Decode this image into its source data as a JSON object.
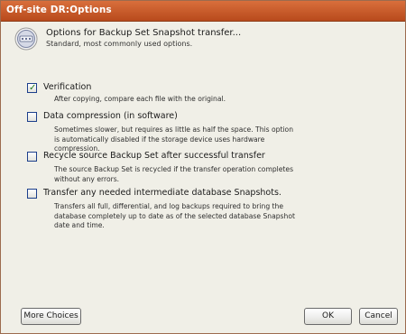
{
  "window": {
    "title": "Off-site DR:Options"
  },
  "header": {
    "title": "Options for Backup Set Snapshot transfer...",
    "subtitle": "Standard, most commonly used options."
  },
  "options": [
    {
      "label": "Verification",
      "checked": true,
      "description": "After copying, compare each file with the original."
    },
    {
      "label": "Data compression (in software)",
      "checked": false,
      "description": "Sometimes slower, but requires as little as half the space. This option is automatically disabled if the storage device uses hardware compression."
    },
    {
      "label": "Recycle source Backup Set after successful transfer",
      "checked": false,
      "description": "The source Backup Set is recycled if the transfer operation completes without any errors."
    },
    {
      "label": "Transfer any needed intermediate database Snapshots.",
      "checked": false,
      "description": "Transfers all full, differential, and log backups required to bring the database completely up to date as of the selected database Snapshot date and time."
    }
  ],
  "buttons": {
    "more_choices": "More Choices",
    "ok": "OK",
    "cancel": "Cancel"
  },
  "colors": {
    "titlebar": "#c8582a",
    "background": "#f0efe7",
    "checkbox_border": "#1c3f8c",
    "checkmark": "#1f7a1f"
  }
}
